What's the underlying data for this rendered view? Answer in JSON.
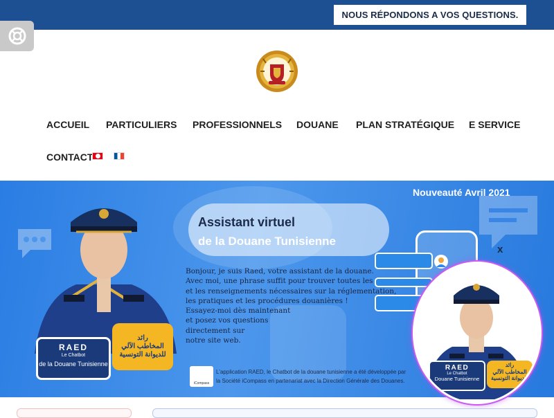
{
  "topbar": {
    "cta_label": "NOUS RÉPONDONS A VOS QUESTIONS.",
    "accessibility_icon": "lifebuoy-icon",
    "color": "#1d4f93"
  },
  "header": {
    "logo_icon": "customs-emblem-logo"
  },
  "nav": {
    "items": [
      "ACCUEIL",
      "PARTICULIERS",
      "PROFESSIONNELS",
      "DOUANE",
      "PLAN STRATÉGIQUE",
      "E SERVICE",
      "CONTACT"
    ],
    "languages": [
      "tunisia-flag-icon",
      "france-flag-icon"
    ]
  },
  "banner": {
    "tag": "Nouveauté Avril 2021",
    "title": "Assistant virtuel",
    "subtitle": "de la Douane Tunisienne",
    "intro_lines": [
      "Bonjour, je suis Raed,  votre assistant de la douane.",
      "Avec moi, une phrase suffit pour trouver toutes les informations",
      "et les renseignements nécessaires sur la réglementation,",
      "les pratiques et les procédures douanières !",
      "Essayez-moi  dès maintenant",
      "et posez vos  questions",
      "directement sur",
      "notre site web."
    ],
    "raed_name": "RAED",
    "raed_sub": "Le Chatbot",
    "raed_org": "de la Douane Tunisienne",
    "raed_ar_1": "رائد",
    "raed_ar_2": "المخاطب الآلي",
    "raed_ar_3": "للديوانة التونسية",
    "logo_caption": "iCompass",
    "credit_lines": [
      "L'application RAED, le Chatbot de la douane tunisienne a été développée par",
      "la Société iCompass en partenariat avec la Direction Générale des Douanes."
    ],
    "accent_color": "#2a7de3"
  },
  "chat_widget": {
    "close_label": "x",
    "raed_name": "RAED",
    "raed_sub": "Le Chatbot",
    "raed_org": "Douane Tunisienne",
    "raed_ar_1": "رائد",
    "raed_ar_2": "المخاطب الآلي",
    "raed_ar_3": "للديوانة التونسية"
  }
}
